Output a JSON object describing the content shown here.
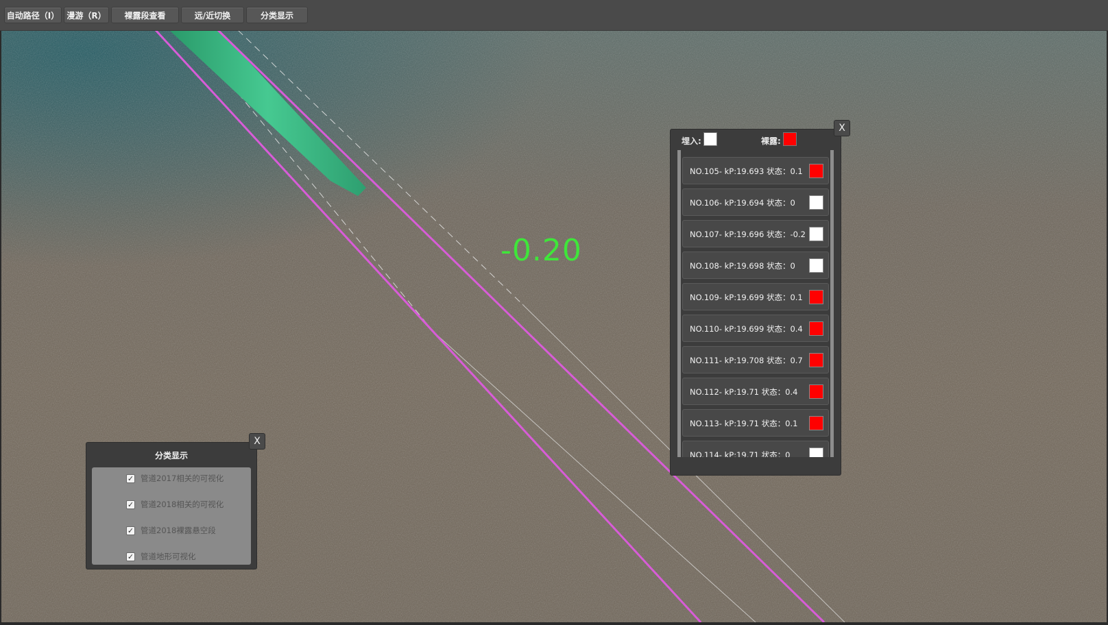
{
  "toolbar": {
    "buttons": [
      {
        "label": "自动路径（I）"
      },
      {
        "label": "漫游（R）"
      },
      {
        "label": "裸露段查看"
      },
      {
        "label": "远/近切换"
      },
      {
        "label": "分类显示"
      }
    ]
  },
  "scene": {
    "depth_value": "-0.20",
    "colors": {
      "pipeline_boundary": "#d85cd8",
      "pipeline_body": "#3cbf8a",
      "depth_label": "#3fe63a"
    }
  },
  "status_panel": {
    "close_label": "X",
    "legend": {
      "buried_label": "埋入:",
      "buried_color": "#ffffff",
      "exposed_label": "裸露:",
      "exposed_color": "#ff0000"
    },
    "rows": [
      {
        "text": "NO.105- kP:19.693  状态：0.1",
        "color": "#ff0000"
      },
      {
        "text": "NO.106- kP:19.694  状态：0",
        "color": "#ffffff"
      },
      {
        "text": "NO.107- kP:19.696  状态：-0.2",
        "color": "#ffffff"
      },
      {
        "text": "NO.108- kP:19.698  状态：0",
        "color": "#ffffff"
      },
      {
        "text": "NO.109- kP:19.699  状态：0.1",
        "color": "#ff0000"
      },
      {
        "text": "NO.110- kP:19.699  状态：0.4",
        "color": "#ff0000"
      },
      {
        "text": "NO.111- kP:19.708  状态：0.7",
        "color": "#ff0000"
      },
      {
        "text": "NO.112- kP:19.71  状态：0.4",
        "color": "#ff0000"
      },
      {
        "text": "NO.113- kP:19.71  状态：0.1",
        "color": "#ff0000"
      },
      {
        "text": "NO.114- kP:19.71  状态：0",
        "color": "#ffffff"
      }
    ]
  },
  "category_panel": {
    "title": "分类显示",
    "close_label": "X",
    "items": [
      {
        "label": "管道2017相关的可视化",
        "checked": true
      },
      {
        "label": "管道2018相关的可视化",
        "checked": true
      },
      {
        "label": "管道2018裸露悬空段",
        "checked": true
      },
      {
        "label": "管道地形可视化",
        "checked": true
      }
    ]
  }
}
